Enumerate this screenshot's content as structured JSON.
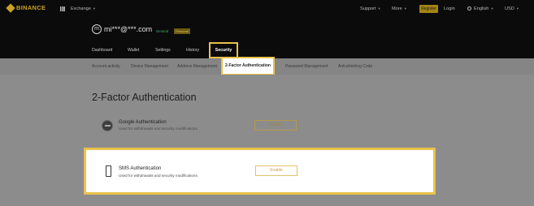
{
  "topnav": {
    "brand": "BINANCE",
    "exchange": "Exchange",
    "support": "Support",
    "more": "More",
    "register": "Register",
    "login": "Login",
    "language": "English",
    "currency": "USD"
  },
  "account": {
    "avatar_letter": "m",
    "email": "mi***@***.com",
    "level": "General",
    "type": "Personal",
    "tabs": [
      "Dashboard",
      "Wallet",
      "Settings",
      "History",
      "Security"
    ]
  },
  "security_tabs": [
    "Account activity",
    "Device Management",
    "Address Management",
    "2-Factor Authentication",
    "Password Management",
    "Anti-phishing Code"
  ],
  "page": {
    "title": "2-Factor Authentication",
    "google": {
      "title": "Google Authentication",
      "desc": "Used for withdrawals and security modifications",
      "button": "Enable"
    },
    "sms": {
      "title": "SMS Authentication",
      "desc": "Used for withdrawals and security modifications",
      "button": "Enable"
    }
  },
  "colors": {
    "accent": "#e8c24a",
    "brand": "#c9a227",
    "general": "#4ab07a"
  }
}
